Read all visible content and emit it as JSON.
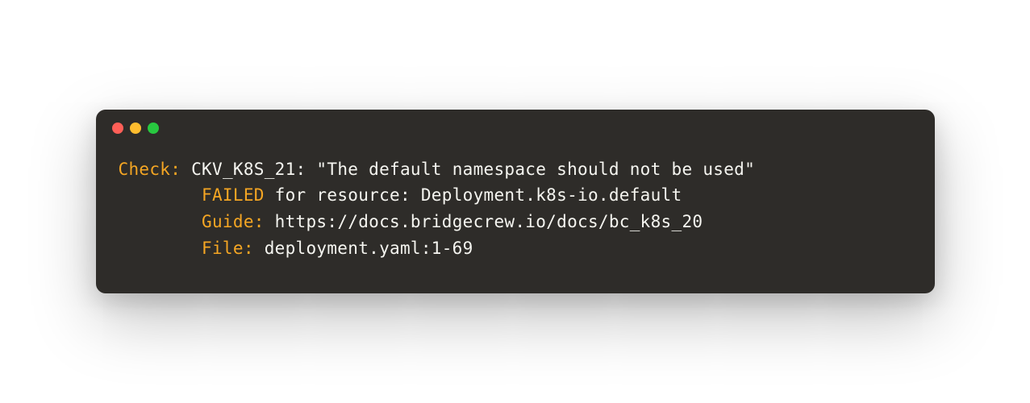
{
  "colors": {
    "orange": "#f5a623",
    "white": "#f5f5f0",
    "bg": "#2e2c29",
    "red": "#ff5f57",
    "yellow": "#febc2e",
    "green": "#28c840"
  },
  "line1": {
    "check_label": "Check:",
    "check_text": " CKV_K8S_21: \"The default namespace should not be used\""
  },
  "line2": {
    "indent": "\t",
    "failed_label": "FAILED",
    "failed_text": " for resource: Deployment.k8s-io.default"
  },
  "line3": {
    "indent": "\t",
    "guide_label": "Guide:",
    "guide_text": " https://docs.bridgecrew.io/docs/bc_k8s_20"
  },
  "line4": {
    "indent": "\t",
    "file_label": "File:",
    "file_text": " deployment.yaml:1-69"
  }
}
